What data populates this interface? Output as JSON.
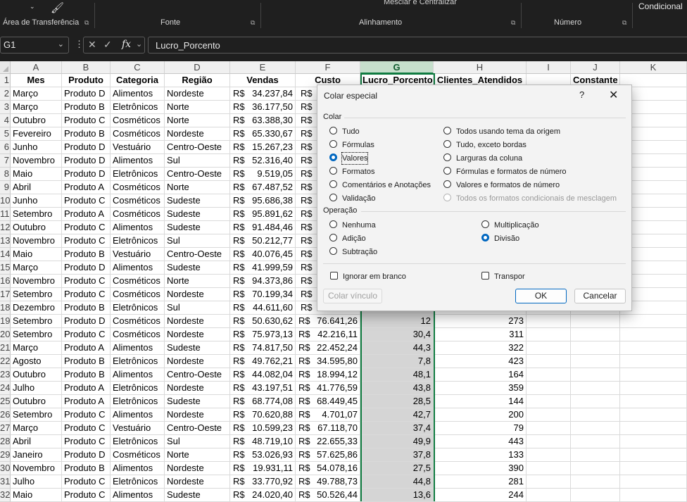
{
  "ribbon": {
    "groups": [
      "Área de Transferência",
      "Fonte",
      "Alinhamento",
      "Número"
    ],
    "merge_label": "Mesclar e Centralizar",
    "conditional_label": "Condicional"
  },
  "formula_bar": {
    "name_box": "G1",
    "formula": "Lucro_Porcento"
  },
  "columns": [
    "A",
    "B",
    "C",
    "D",
    "E",
    "F",
    "G",
    "H",
    "I",
    "J",
    "K"
  ],
  "headers": [
    "Mes",
    "Produto",
    "Categoria",
    "Região",
    "Vendas",
    "Custo",
    "Lucro_Porcento",
    "Clientes_Atendidos",
    "",
    "Constante",
    ""
  ],
  "rows": [
    [
      "Março",
      "Produto D",
      "Alimentos",
      "Nordeste",
      "34.237,84",
      "",
      "",
      "",
      ""
    ],
    [
      "Março",
      "Produto B",
      "Eletrônicos",
      "Norte",
      "36.177,50",
      "",
      "",
      "",
      ""
    ],
    [
      "Outubro",
      "Produto C",
      "Cosméticos",
      "Norte",
      "63.388,30",
      "",
      "",
      "",
      ""
    ],
    [
      "Fevereiro",
      "Produto B",
      "Cosméticos",
      "Nordeste",
      "65.330,67",
      "",
      "",
      "",
      ""
    ],
    [
      "Junho",
      "Produto D",
      "Vestuário",
      "Centro-Oeste",
      "15.267,23",
      "",
      "",
      "",
      ""
    ],
    [
      "Novembro",
      "Produto D",
      "Alimentos",
      "Sul",
      "52.316,40",
      "",
      "",
      "",
      ""
    ],
    [
      "Maio",
      "Produto D",
      "Eletrônicos",
      "Centro-Oeste",
      "9.519,05",
      "",
      "",
      "",
      ""
    ],
    [
      "Abril",
      "Produto A",
      "Cosméticos",
      "Norte",
      "67.487,52",
      "",
      "",
      "",
      ""
    ],
    [
      "Junho",
      "Produto C",
      "Cosméticos",
      "Sudeste",
      "95.686,38",
      "",
      "",
      "",
      ""
    ],
    [
      "Setembro",
      "Produto A",
      "Cosméticos",
      "Sudeste",
      "95.891,62",
      "",
      "",
      "",
      ""
    ],
    [
      "Outubro",
      "Produto C",
      "Alimentos",
      "Sudeste",
      "91.484,46",
      "",
      "",
      "",
      ""
    ],
    [
      "Novembro",
      "Produto C",
      "Eletrônicos",
      "Sul",
      "50.212,77",
      "",
      "",
      "",
      ""
    ],
    [
      "Maio",
      "Produto B",
      "Vestuário",
      "Centro-Oeste",
      "40.076,45",
      "",
      "",
      "",
      ""
    ],
    [
      "Março",
      "Produto D",
      "Alimentos",
      "Sudeste",
      "41.999,59",
      "",
      "",
      "",
      ""
    ],
    [
      "Novembro",
      "Produto C",
      "Cosméticos",
      "Norte",
      "94.373,86",
      "",
      "",
      "",
      ""
    ],
    [
      "Setembro",
      "Produto C",
      "Cosméticos",
      "Nordeste",
      "70.199,34",
      "",
      "",
      "",
      ""
    ],
    [
      "Dezembro",
      "Produto B",
      "Eletrônicos",
      "Sul",
      "44.611,60",
      "",
      "",
      "",
      ""
    ],
    [
      "Setembro",
      "Produto D",
      "Cosméticos",
      "Nordeste",
      "50.630,62",
      "76.641,26",
      "12",
      "273"
    ],
    [
      "Setembro",
      "Produto C",
      "Cosméticos",
      "Nordeste",
      "75.973,13",
      "42.216,11",
      "30,4",
      "311"
    ],
    [
      "Março",
      "Produto A",
      "Alimentos",
      "Sudeste",
      "74.817,50",
      "22.452,24",
      "44,3",
      "322"
    ],
    [
      "Agosto",
      "Produto B",
      "Eletrônicos",
      "Nordeste",
      "49.762,21",
      "34.595,80",
      "7,8",
      "423"
    ],
    [
      "Outubro",
      "Produto B",
      "Alimentos",
      "Centro-Oeste",
      "44.082,04",
      "18.994,12",
      "48,1",
      "164"
    ],
    [
      "Julho",
      "Produto A",
      "Eletrônicos",
      "Nordeste",
      "43.197,51",
      "41.776,59",
      "43,8",
      "359"
    ],
    [
      "Outubro",
      "Produto A",
      "Eletrônicos",
      "Sudeste",
      "68.774,08",
      "68.449,45",
      "28,5",
      "144"
    ],
    [
      "Setembro",
      "Produto C",
      "Alimentos",
      "Nordeste",
      "70.620,88",
      "4.701,07",
      "42,7",
      "200"
    ],
    [
      "Março",
      "Produto C",
      "Vestuário",
      "Centro-Oeste",
      "10.599,23",
      "67.118,70",
      "37,4",
      "79"
    ],
    [
      "Abril",
      "Produto C",
      "Eletrônicos",
      "Sul",
      "48.719,10",
      "22.655,33",
      "49,9",
      "443"
    ],
    [
      "Janeiro",
      "Produto D",
      "Cosméticos",
      "Norte",
      "53.026,93",
      "57.625,86",
      "37,8",
      "133"
    ],
    [
      "Novembro",
      "Produto B",
      "Alimentos",
      "Nordeste",
      "19.931,11",
      "54.078,16",
      "27,5",
      "390"
    ],
    [
      "Julho",
      "Produto C",
      "Eletrônicos",
      "Nordeste",
      "33.770,92",
      "49.788,73",
      "44,8",
      "281"
    ],
    [
      "Maio",
      "Produto C",
      "Alimentos",
      "Sudeste",
      "24.020,40",
      "50.526,44",
      "13,6",
      "244"
    ]
  ],
  "currency": "R$",
  "dialog": {
    "title": "Colar especial",
    "help": "?",
    "close": "✕",
    "paste_section": "Colar",
    "paste_left": [
      "Tudo",
      "Fórmulas",
      "Valores",
      "Formatos",
      "Comentários e Anotações",
      "Validação"
    ],
    "paste_right": [
      "Todos usando tema da origem",
      "Tudo, exceto bordas",
      "Larguras da coluna",
      "Fórmulas e formatos de número",
      "Valores e formatos de número",
      "Todos os formatos condicionais de mesclagem"
    ],
    "operation_section": "Operação",
    "op_left": [
      "Nenhuma",
      "Adição",
      "Subtração"
    ],
    "op_right": [
      "Multiplicação",
      "Divisão"
    ],
    "skip_blanks": "Ignorar em branco",
    "transpose": "Transpor",
    "paste_link": "Colar vínculo",
    "ok": "OK",
    "cancel": "Cancelar"
  }
}
